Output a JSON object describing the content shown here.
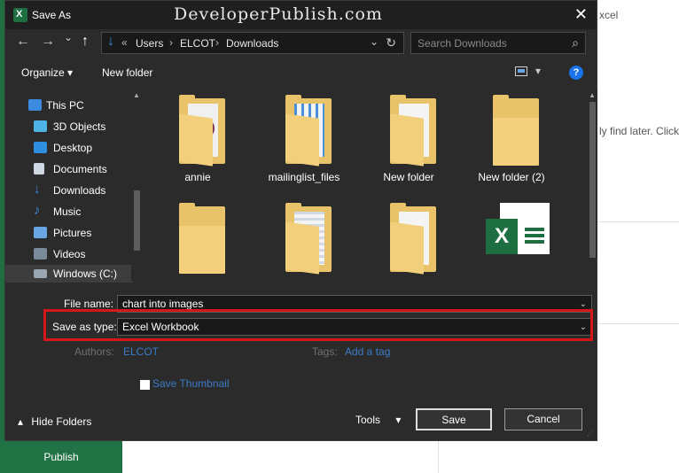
{
  "background": {
    "publish_label": "Publish",
    "snippet_excel": "xcel",
    "snippet_text": "ly find later. Click"
  },
  "dialog": {
    "title": "Save As",
    "watermark": "DeveloperPublish.com",
    "close_symbol": "✕"
  },
  "nav": {
    "back_symbol": "←",
    "forward_symbol": "→",
    "recent_symbol": "⌄",
    "up_symbol": "↑",
    "breadcrumb_prefix": "«",
    "breadcrumbs": [
      "Users",
      "ELCOT",
      "Downloads"
    ],
    "breadcrumb_separator": "›",
    "search_placeholder": "Search Downloads"
  },
  "toolbar": {
    "organize_label": "Organize ▾",
    "new_folder_label": "New folder",
    "help_label": "?"
  },
  "sidebar": {
    "items": [
      {
        "label": "This PC",
        "icon": "monitor-icon",
        "color": "#3b8be0"
      },
      {
        "label": "3D Objects",
        "icon": "cube-icon",
        "color": "#4fb3e8"
      },
      {
        "label": "Desktop",
        "icon": "desktop-icon",
        "color": "#2f8ee0"
      },
      {
        "label": "Documents",
        "icon": "document-icon",
        "color": "#cfd8e3"
      },
      {
        "label": "Downloads",
        "icon": "download-icon",
        "color": "#3b8be0"
      },
      {
        "label": "Music",
        "icon": "music-note-icon",
        "color": "#3b8be0"
      },
      {
        "label": "Pictures",
        "icon": "picture-icon",
        "color": "#6aa6e6"
      },
      {
        "label": "Videos",
        "icon": "film-icon",
        "color": "#7a8a9a"
      },
      {
        "label": "Windows (C:)",
        "icon": "drive-icon",
        "color": "#9aa6b2"
      }
    ]
  },
  "files": [
    {
      "name": "annie",
      "type": "folder"
    },
    {
      "name": "mailinglist_files",
      "type": "folder"
    },
    {
      "name": "New folder",
      "type": "folder"
    },
    {
      "name": "New folder (2)",
      "type": "folder"
    },
    {
      "name": "",
      "type": "folder"
    },
    {
      "name": "",
      "type": "folder"
    },
    {
      "name": "",
      "type": "folder"
    },
    {
      "name": "",
      "type": "excel-file"
    }
  ],
  "form": {
    "filename_label": "File name:",
    "filename_value": "chart into images",
    "savetype_label": "Save as type:",
    "savetype_value": "Excel Workbook",
    "authors_label": "Authors:",
    "authors_value": "ELCOT",
    "tags_label": "Tags:",
    "tags_value": "Add a tag",
    "thumbnail_label": "Save Thumbnail"
  },
  "footer": {
    "hide_folders_label": "Hide Folders",
    "tools_label": "Tools",
    "save_label": "Save",
    "cancel_label": "Cancel"
  },
  "colors": {
    "highlight": "#d5171b",
    "excel_green": "#1d6f42",
    "dialog_bg": "#2b2b2b"
  }
}
